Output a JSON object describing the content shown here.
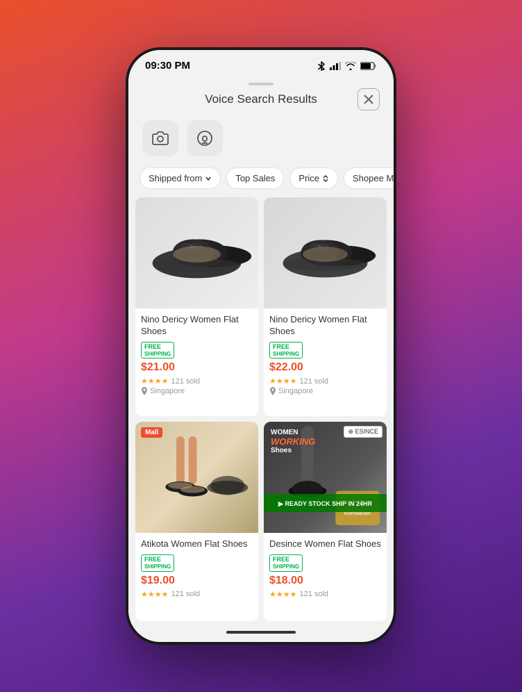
{
  "status_bar": {
    "time": "09:30 PM"
  },
  "sheet": {
    "handle_visible": true,
    "title": "Voice Search Results",
    "close_label": "×"
  },
  "filter_bar": {
    "filters": [
      {
        "id": "shipped-from",
        "label": "Shipped from",
        "has_arrow": true,
        "active": false
      },
      {
        "id": "top-sales",
        "label": "Top Sales",
        "has_arrow": false,
        "active": false
      },
      {
        "id": "price",
        "label": "Price",
        "has_arrow": true,
        "active": false
      },
      {
        "id": "shopee-mall",
        "label": "Shopee Mall",
        "has_arrow": false,
        "active": false
      }
    ]
  },
  "products": [
    {
      "id": 1,
      "name": "Nino Dericy Women Flat Shoes",
      "free_shipping": true,
      "price": "$21.00",
      "stars": 4,
      "sold": "121 sold",
      "location": "Singapore",
      "is_mall": false,
      "img_class": "product-img-1"
    },
    {
      "id": 2,
      "name": "Nino Dericy Women Flat Shoes",
      "free_shipping": true,
      "price": "$22.00",
      "stars": 4,
      "sold": "121 sold",
      "location": "Singapore",
      "is_mall": false,
      "img_class": "product-img-2"
    },
    {
      "id": 3,
      "name": "Atikota Women Flat Shoes",
      "free_shipping": true,
      "price": "$19.00",
      "stars": 4,
      "sold": "121 sold",
      "location": "",
      "is_mall": true,
      "img_class": "product-img-3"
    },
    {
      "id": 4,
      "name": "Desince Women Flat Shoes",
      "free_shipping": true,
      "price": "$18.00",
      "stars": 4,
      "sold": "121 sold",
      "location": "",
      "is_mall": false,
      "img_class": "product-img-4"
    }
  ],
  "labels": {
    "free": "FREE",
    "shipping": "SHIPPING",
    "mall": "Mall",
    "esince": "ESINCE",
    "women_working_shoes": "WOMEN WORKING Shoes",
    "ready_stock": "READY STOCK SHIP IN 24HR",
    "ramadhan": "3·3 Ramadhan"
  }
}
